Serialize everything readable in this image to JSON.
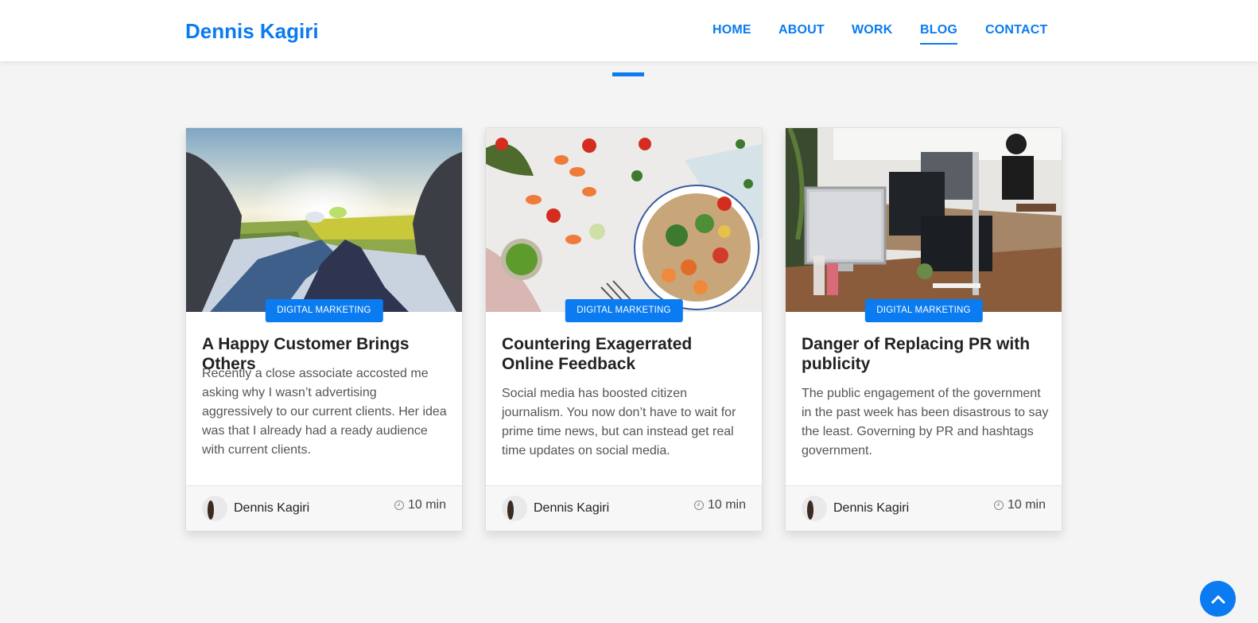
{
  "header": {
    "brand": "Dennis Kagiri",
    "nav": [
      {
        "label": "HOME"
      },
      {
        "label": "ABOUT"
      },
      {
        "label": "WORK"
      },
      {
        "label": "BLOG",
        "active": true
      },
      {
        "label": "CONTACT"
      }
    ]
  },
  "posts": [
    {
      "category": "DIGITAL MARKETING",
      "title": "A Happy Customer Brings Others",
      "excerpt": "Recently a close associate accosted me asking why I wasn’t advertising aggressively to our current clients. Her idea was that I already had a ready audience with current clients.",
      "author": "Dennis Kagiri",
      "read_time": "10 min"
    },
    {
      "category": "DIGITAL MARKETING",
      "title": "Countering Exagerrated Online Feedback",
      "excerpt": "Social media has boosted citizen journalism. You now don’t have to wait for prime time news, but can instead get real time updates on social media.",
      "author": "Dennis Kagiri",
      "read_time": "10 min"
    },
    {
      "category": "DIGITAL MARKETING",
      "title": "Danger of Replacing PR with publicity",
      "excerpt": "The public engagement of the government in the past week has been disastrous to say the least. Governing by PR and hashtags government.",
      "author": "Dennis Kagiri",
      "read_time": "10 min"
    }
  ],
  "icons": {
    "clock": "clock-icon",
    "scroll_top": "chevron-up-icon"
  },
  "colors": {
    "accent": "#0a7bf0",
    "background": "#f4f4f4"
  }
}
